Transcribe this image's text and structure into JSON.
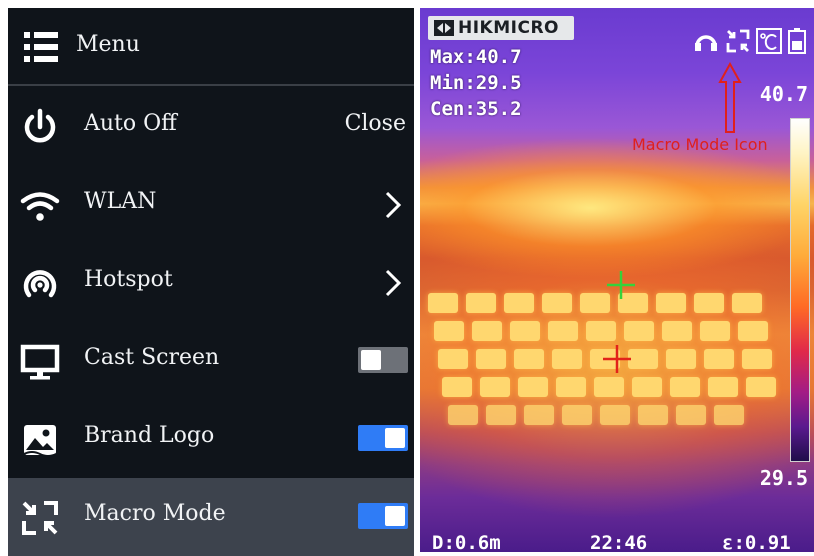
{
  "menu": {
    "title": "Menu",
    "items": [
      {
        "label": "Auto Off",
        "value": "Close",
        "icon": "power-icon"
      },
      {
        "label": "WLAN",
        "icon": "wifi-icon"
      },
      {
        "label": "Hotspot",
        "icon": "hotspot-icon"
      },
      {
        "label": "Cast Screen",
        "icon": "monitor-icon",
        "toggle": "off"
      },
      {
        "label": "Brand Logo",
        "icon": "image-icon",
        "toggle": "on"
      },
      {
        "label": "Macro Mode",
        "icon": "macro-icon",
        "toggle": "on",
        "selected": true
      }
    ]
  },
  "thermal": {
    "brand": "HIKMICRO",
    "max": "Max:40.7",
    "min": "Min:29.5",
    "cen": "Cen:35.2",
    "scale_max": "40.7",
    "scale_min": "29.5",
    "annotation": "Macro Mode Icon",
    "distance": "D:0.6m",
    "time": "22:46",
    "emissivity": "ε:0.91",
    "status_icons": [
      "headset-icon",
      "macro-icon",
      "celsius-icon",
      "battery-icon"
    ]
  },
  "colors": {
    "menu_bg": "#0f141a",
    "selected_row": "#3d434d",
    "toggle_on": "#2f7cf6",
    "toggle_off": "#6d7178",
    "annotation": "#e0201c"
  }
}
